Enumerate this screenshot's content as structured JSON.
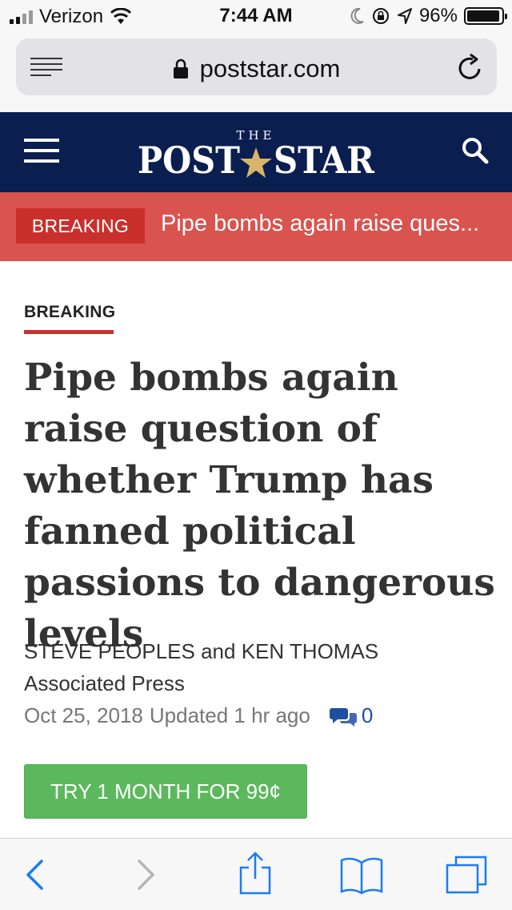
{
  "status_bar": {
    "carrier": "Verizon",
    "time": "7:44 AM",
    "battery_percent": "96%",
    "battery_level": 0.96
  },
  "browser": {
    "url": "poststar.com"
  },
  "site": {
    "logo": "THE POST STAR"
  },
  "breaking_banner": {
    "tag": "BREAKING",
    "headline": "Pipe bombs again raise ques..."
  },
  "article": {
    "kicker": "BREAKING",
    "headline": "Pipe bombs again raise question of whether Trump has fanned political passions to dangerous levels",
    "byline": "STEVE PEOPLES and KEN THOMAS",
    "source": "Associated Press",
    "date": "Oct 25, 2018",
    "updated": "Updated 1 hr ago",
    "comment_count": "0",
    "cta": "TRY 1 MONTH FOR 99¢"
  },
  "colors": {
    "header_bg": "#0a1e50",
    "banner_bg": "#d9534f",
    "tag_bg": "#c9302c",
    "cta_bg": "#5cb85c",
    "link": "#1f4fa0",
    "ios_blue": "#1a7cf5"
  },
  "icons": [
    "signal-icon",
    "wifi-icon",
    "moon-icon",
    "rotation-lock-icon",
    "location-icon",
    "battery-icon",
    "reader-icon",
    "lock-icon",
    "reload-icon",
    "menu-icon",
    "star-icon",
    "search-icon",
    "comment-icon",
    "back-icon",
    "forward-icon",
    "share-icon",
    "bookmarks-icon",
    "tabs-icon"
  ]
}
